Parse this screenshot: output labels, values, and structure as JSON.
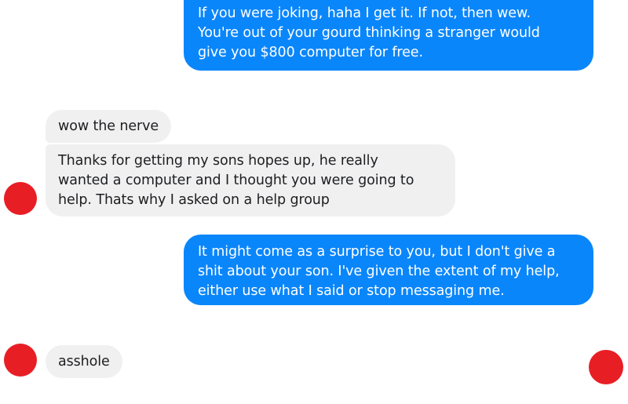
{
  "conversation": {
    "messages": [
      {
        "sender": "me",
        "text": "If you were joking, haha I get it. If not, then wew.\nYou're out of your gourd thinking a stranger would\ngive you $800 computer for free."
      },
      {
        "sender": "them",
        "text": "wow the nerve"
      },
      {
        "sender": "them",
        "text": "Thanks for getting my sons hopes up, he really\nwanted a computer and I thought you were going to\nhelp. Thats why I asked on a help group"
      },
      {
        "sender": "me",
        "text": "It might come as a surprise to you, but I don't give a\nshit about your son. I've given the extent of my help,\neither use what I said or stop messaging me."
      },
      {
        "sender": "them",
        "text": "asshole"
      }
    ]
  },
  "colors": {
    "sent_bubble": "#0a86fb",
    "received_bubble": "#f1f0f0",
    "avatar_redaction": "#e81e25"
  }
}
